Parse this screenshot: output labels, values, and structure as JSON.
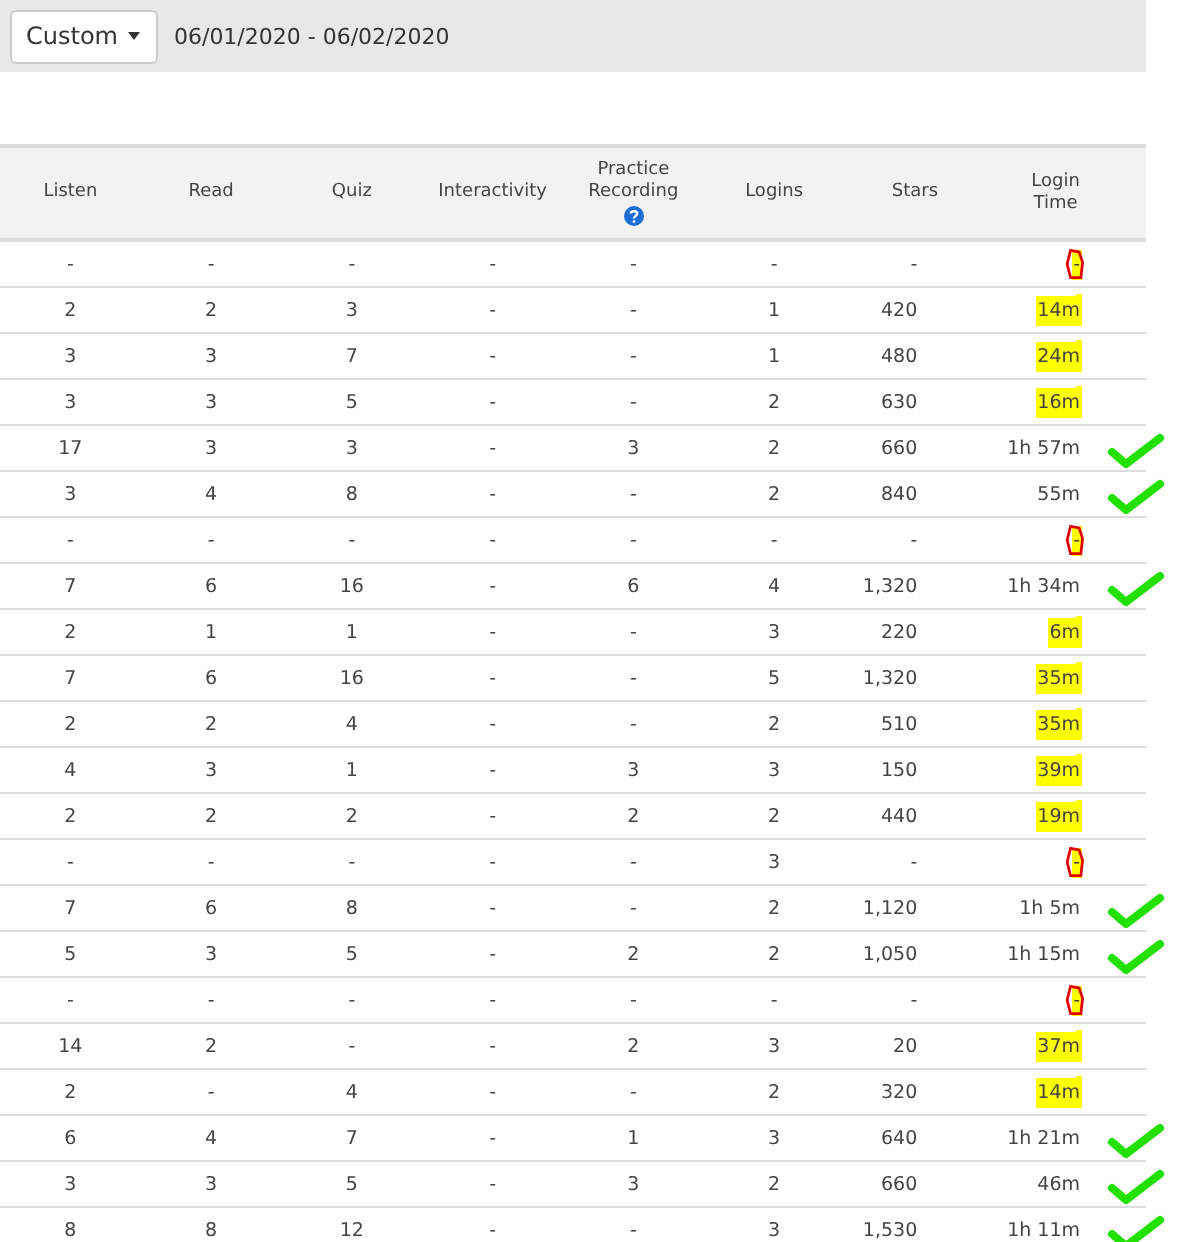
{
  "filter": {
    "range_select": "Custom",
    "date_range": "06/01/2020 - 06/02/2020"
  },
  "table": {
    "columns": [
      {
        "label": "Listen",
        "info": false
      },
      {
        "label": "Read",
        "info": false
      },
      {
        "label": "Quiz",
        "info": false
      },
      {
        "label": "Interactivity",
        "info": false
      },
      {
        "label": "Practice Recording",
        "info": true
      },
      {
        "label": "Logins",
        "info": false
      },
      {
        "label": "Stars",
        "info": false
      },
      {
        "label": "Login Time",
        "info": false
      }
    ],
    "rows": [
      {
        "cells": [
          "-",
          "-",
          "-",
          "-",
          "-",
          "-",
          "-",
          "-"
        ],
        "kind": "circle"
      },
      {
        "cells": [
          "2",
          "2",
          "3",
          "-",
          "-",
          "1",
          "420",
          "14m"
        ],
        "kind": "highlight"
      },
      {
        "cells": [
          "3",
          "3",
          "7",
          "-",
          "-",
          "1",
          "480",
          "24m"
        ],
        "kind": "highlight"
      },
      {
        "cells": [
          "3",
          "3",
          "5",
          "-",
          "-",
          "2",
          "630",
          "16m"
        ],
        "kind": "highlight"
      },
      {
        "cells": [
          "17",
          "3",
          "3",
          "-",
          "3",
          "2",
          "660",
          "1h 57m"
        ],
        "kind": "check"
      },
      {
        "cells": [
          "3",
          "4",
          "8",
          "-",
          "-",
          "2",
          "840",
          "55m"
        ],
        "kind": "check"
      },
      {
        "cells": [
          "-",
          "-",
          "-",
          "-",
          "-",
          "-",
          "-",
          "-"
        ],
        "kind": "circle"
      },
      {
        "cells": [
          "7",
          "6",
          "16",
          "-",
          "6",
          "4",
          "1,320",
          "1h 34m"
        ],
        "kind": "check"
      },
      {
        "cells": [
          "2",
          "1",
          "1",
          "-",
          "-",
          "3",
          "220",
          "6m"
        ],
        "kind": "highlight"
      },
      {
        "cells": [
          "7",
          "6",
          "16",
          "-",
          "-",
          "5",
          "1,320",
          "35m"
        ],
        "kind": "highlight"
      },
      {
        "cells": [
          "2",
          "2",
          "4",
          "-",
          "-",
          "2",
          "510",
          "35m"
        ],
        "kind": "highlight"
      },
      {
        "cells": [
          "4",
          "3",
          "1",
          "-",
          "3",
          "3",
          "150",
          "39m"
        ],
        "kind": "highlight"
      },
      {
        "cells": [
          "2",
          "2",
          "2",
          "-",
          "2",
          "2",
          "440",
          "19m"
        ],
        "kind": "highlight"
      },
      {
        "cells": [
          "-",
          "-",
          "-",
          "-",
          "-",
          "3",
          "-",
          "-"
        ],
        "kind": "circle"
      },
      {
        "cells": [
          "7",
          "6",
          "8",
          "-",
          "-",
          "2",
          "1,120",
          "1h 5m"
        ],
        "kind": "check"
      },
      {
        "cells": [
          "5",
          "3",
          "5",
          "-",
          "2",
          "2",
          "1,050",
          "1h 15m"
        ],
        "kind": "check"
      },
      {
        "cells": [
          "-",
          "-",
          "-",
          "-",
          "-",
          "-",
          "-",
          "-"
        ],
        "kind": "circle"
      },
      {
        "cells": [
          "14",
          "2",
          "-",
          "-",
          "2",
          "3",
          "20",
          "37m"
        ],
        "kind": "highlight"
      },
      {
        "cells": [
          "2",
          "-",
          "4",
          "-",
          "-",
          "2",
          "320",
          "14m"
        ],
        "kind": "highlight"
      },
      {
        "cells": [
          "6",
          "4",
          "7",
          "-",
          "1",
          "3",
          "640",
          "1h 21m"
        ],
        "kind": "check"
      },
      {
        "cells": [
          "3",
          "3",
          "5",
          "-",
          "3",
          "2",
          "660",
          "46m"
        ],
        "kind": "check"
      },
      {
        "cells": [
          "8",
          "8",
          "12",
          "-",
          "-",
          "3",
          "1,530",
          "1h 11m"
        ],
        "kind": "check"
      }
    ]
  }
}
